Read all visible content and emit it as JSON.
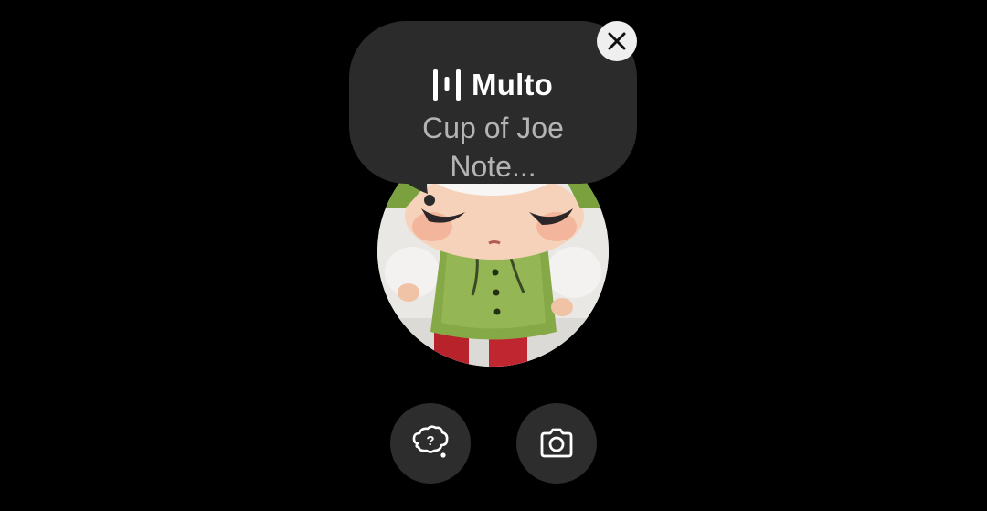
{
  "tooltip": {
    "brand_name": "Multo",
    "brand_logo_icon": "multo-bars-logo-icon",
    "message_line1": "Cup of Joe",
    "message_line2": "Note..."
  },
  "close_button": {
    "icon": "close-icon",
    "background": "#efefef"
  },
  "avatar": {
    "icon": "profile-photo"
  },
  "actions": [
    {
      "icon": "help-cloud-icon"
    },
    {
      "icon": "camera-icon"
    }
  ],
  "colors": {
    "background": "#000000",
    "bubble": "#2b2b2b",
    "button": "#2d2d2d",
    "brand_text": "#ffffff",
    "message_text": "#b4b4b4"
  }
}
